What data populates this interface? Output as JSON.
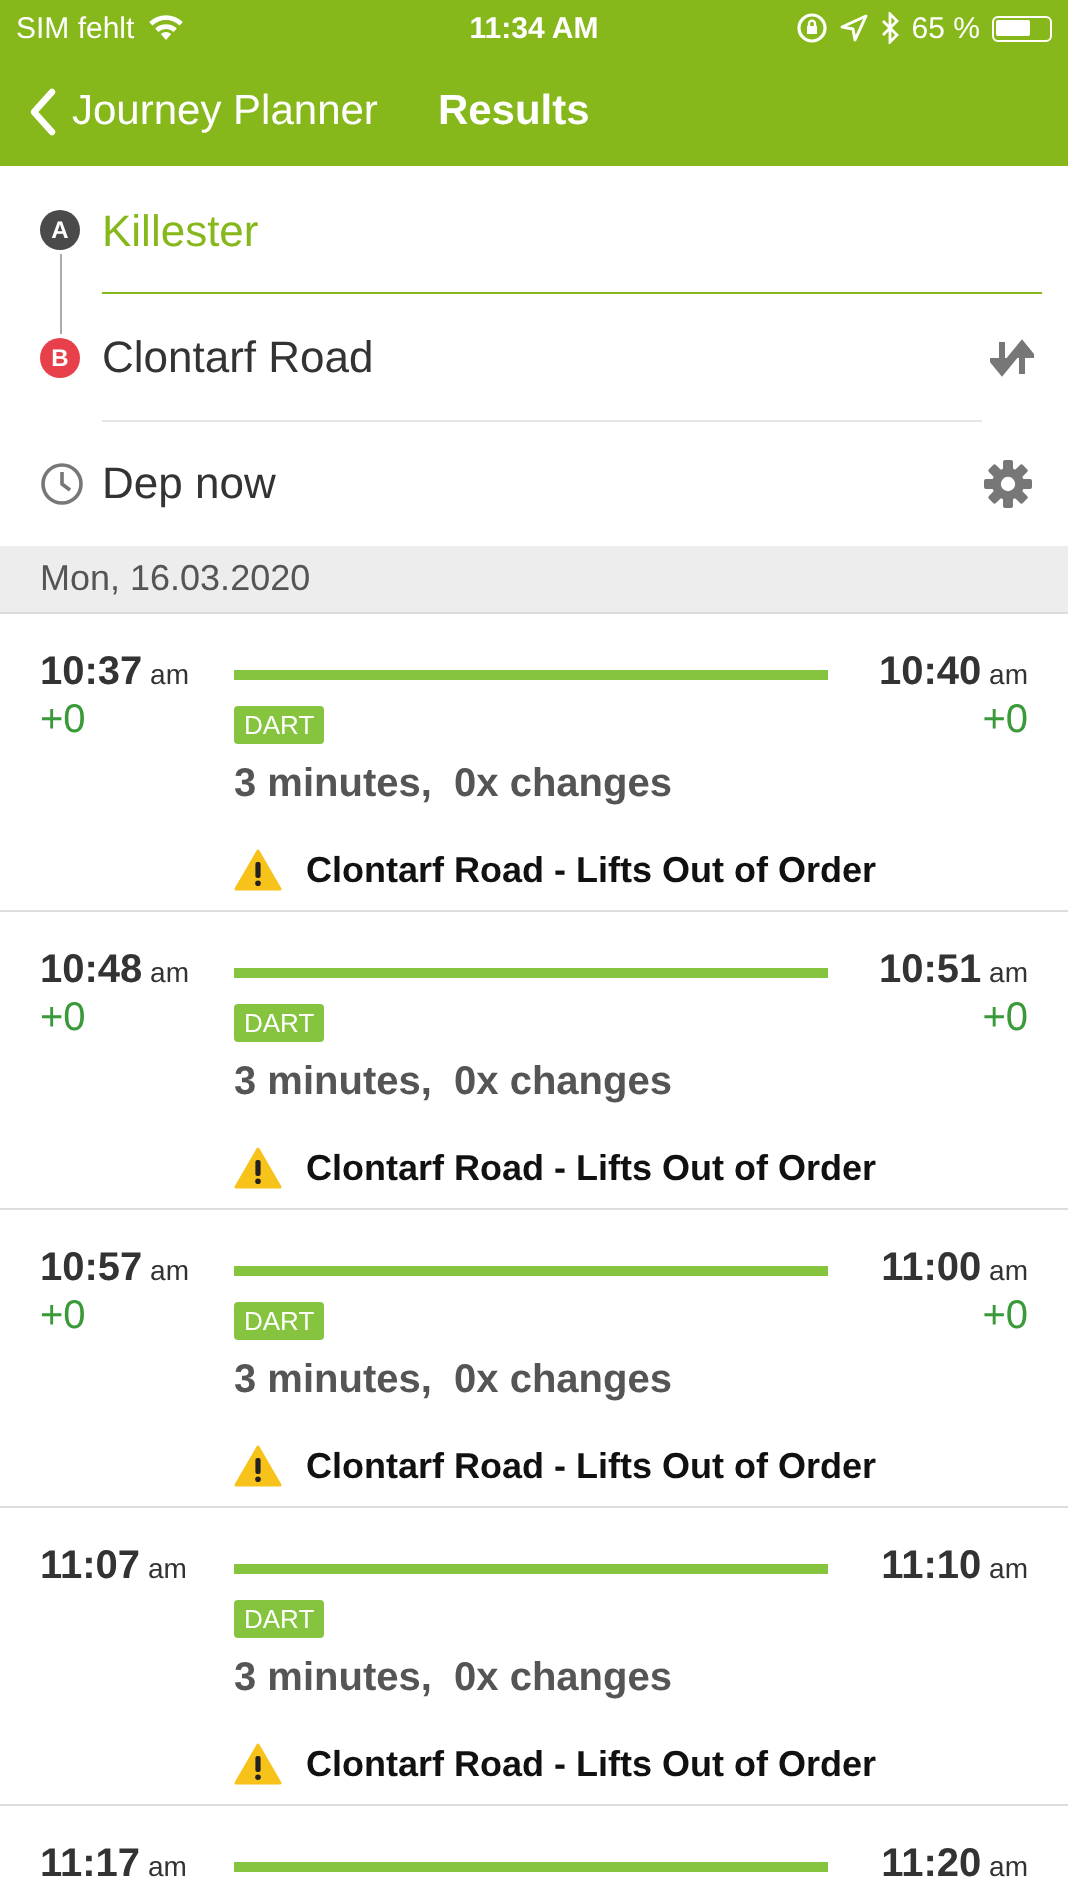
{
  "status_bar": {
    "carrier": "SIM fehlt",
    "time": "11:34 AM",
    "battery": "65 %"
  },
  "nav": {
    "back": "Journey Planner",
    "title": "Results"
  },
  "form": {
    "origin": {
      "badge": "A",
      "value": "Killester",
      "focused": true
    },
    "destination": {
      "badge": "B",
      "value": "Clontarf Road",
      "focused": false
    },
    "time": "Dep now"
  },
  "date": "Mon, 16.03.2020",
  "journeys": [
    {
      "dep": "10:37",
      "dep_suffix": "am",
      "arr": "10:40",
      "arr_suffix": "am",
      "dep_delay": "+0",
      "arr_delay": "+0",
      "product": "DART",
      "duration": "3 minutes,  0x changes",
      "warning": "Clontarf Road - Lifts Out of Order"
    },
    {
      "dep": "10:48",
      "dep_suffix": "am",
      "arr": "10:51",
      "arr_suffix": "am",
      "dep_delay": "+0",
      "arr_delay": "+0",
      "product": "DART",
      "duration": "3 minutes,  0x changes",
      "warning": "Clontarf Road - Lifts Out of Order"
    },
    {
      "dep": "10:57",
      "dep_suffix": "am",
      "arr": "11:00",
      "arr_suffix": "am",
      "dep_delay": "+0",
      "arr_delay": "+0",
      "product": "DART",
      "duration": "3 minutes,  0x changes",
      "warning": "Clontarf Road - Lifts Out of Order"
    },
    {
      "dep": "11:07",
      "dep_suffix": "am",
      "arr": "11:10",
      "arr_suffix": "am",
      "product": "DART",
      "duration": "3 minutes,  0x changes",
      "warning": "Clontarf Road - Lifts Out of Order"
    },
    {
      "dep": "11:17",
      "dep_suffix": "am",
      "arr": "11:20",
      "arr_suffix": "am"
    }
  ]
}
